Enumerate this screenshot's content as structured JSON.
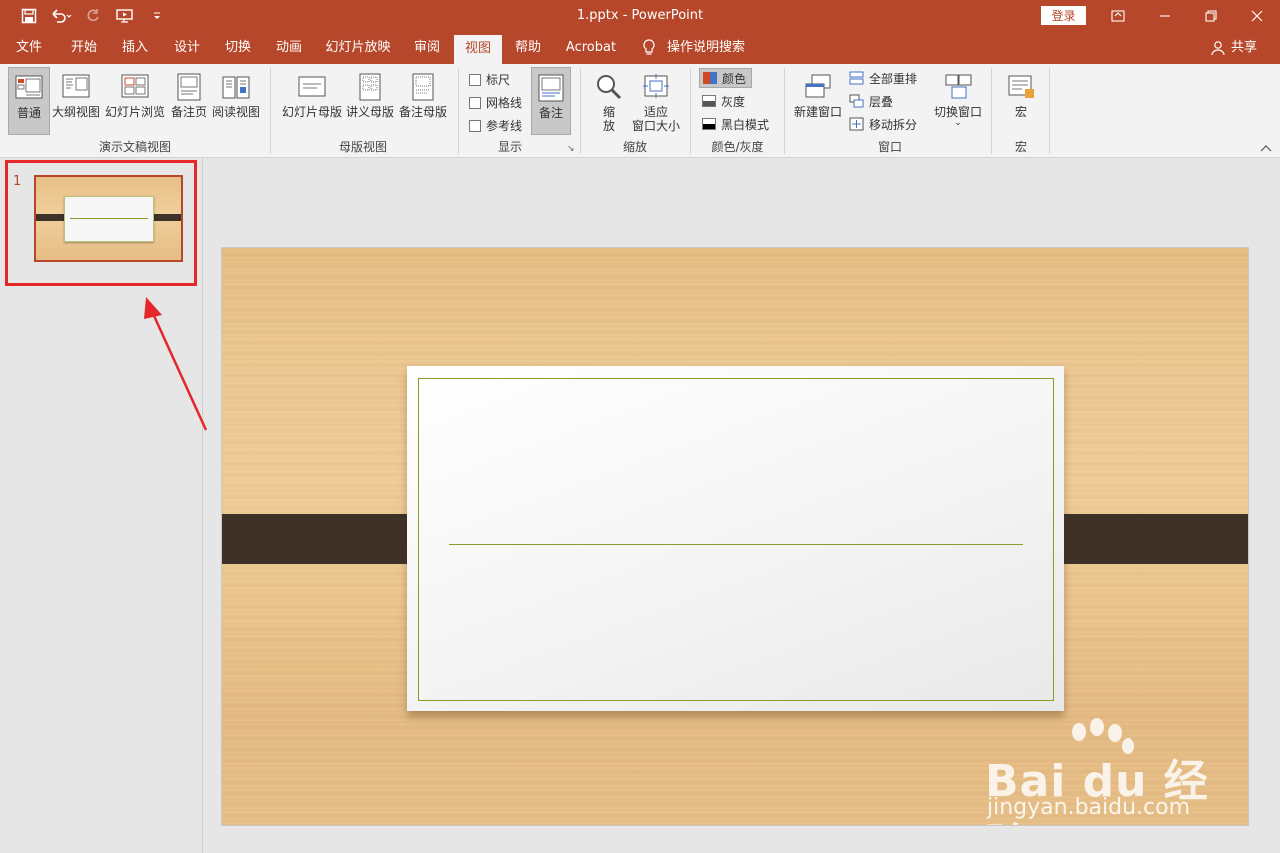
{
  "window": {
    "title": "1.pptx  -  PowerPoint",
    "login": "登录"
  },
  "tabs": [
    {
      "label": "文件"
    },
    {
      "label": "开始"
    },
    {
      "label": "插入"
    },
    {
      "label": "设计"
    },
    {
      "label": "切换"
    },
    {
      "label": "动画"
    },
    {
      "label": "幻灯片放映"
    },
    {
      "label": "审阅"
    },
    {
      "label": "视图"
    },
    {
      "label": "帮助"
    },
    {
      "label": "Acrobat"
    },
    {
      "label": "操作说明搜索"
    },
    {
      "label": "共享"
    }
  ],
  "ribbon": {
    "presentation_views": {
      "label": "演示文稿视图",
      "normal": "普通",
      "outline": "大纲视图",
      "sorter": "幻灯片浏览",
      "notes_page": "备注页",
      "reading": "阅读视图"
    },
    "master_views": {
      "label": "母版视图",
      "slide_master": "幻灯片母版",
      "handout_master": "讲义母版",
      "notes_master": "备注母版"
    },
    "show": {
      "label": "显示",
      "ruler": "标尺",
      "gridlines": "网格线",
      "guides": "参考线",
      "notes": "备注"
    },
    "zoom": {
      "label": "缩放",
      "zoom_l1": "缩",
      "zoom_l2": "放",
      "fit_l1": "适应",
      "fit_l2": "窗口大小"
    },
    "color": {
      "label": "颜色/灰度",
      "color": "颜色",
      "grayscale": "灰度",
      "bw": "黑白模式"
    },
    "window": {
      "label": "窗口",
      "new_window": "新建窗口",
      "arrange_all": "全部重排",
      "cascade": "层叠",
      "move_split": "移动拆分",
      "switch_windows": "切换窗口"
    },
    "macros": {
      "label": "宏",
      "macros": "宏"
    }
  },
  "thumbnails": [
    {
      "number": "1"
    }
  ],
  "watermark": {
    "logo": "Bai du 经验",
    "url": "jingyan.baidu.com"
  },
  "colors": {
    "accent": "#b7472a",
    "highlight": "#e3272b",
    "band": "#3d3128",
    "frame_line": "#8a9a2e"
  }
}
